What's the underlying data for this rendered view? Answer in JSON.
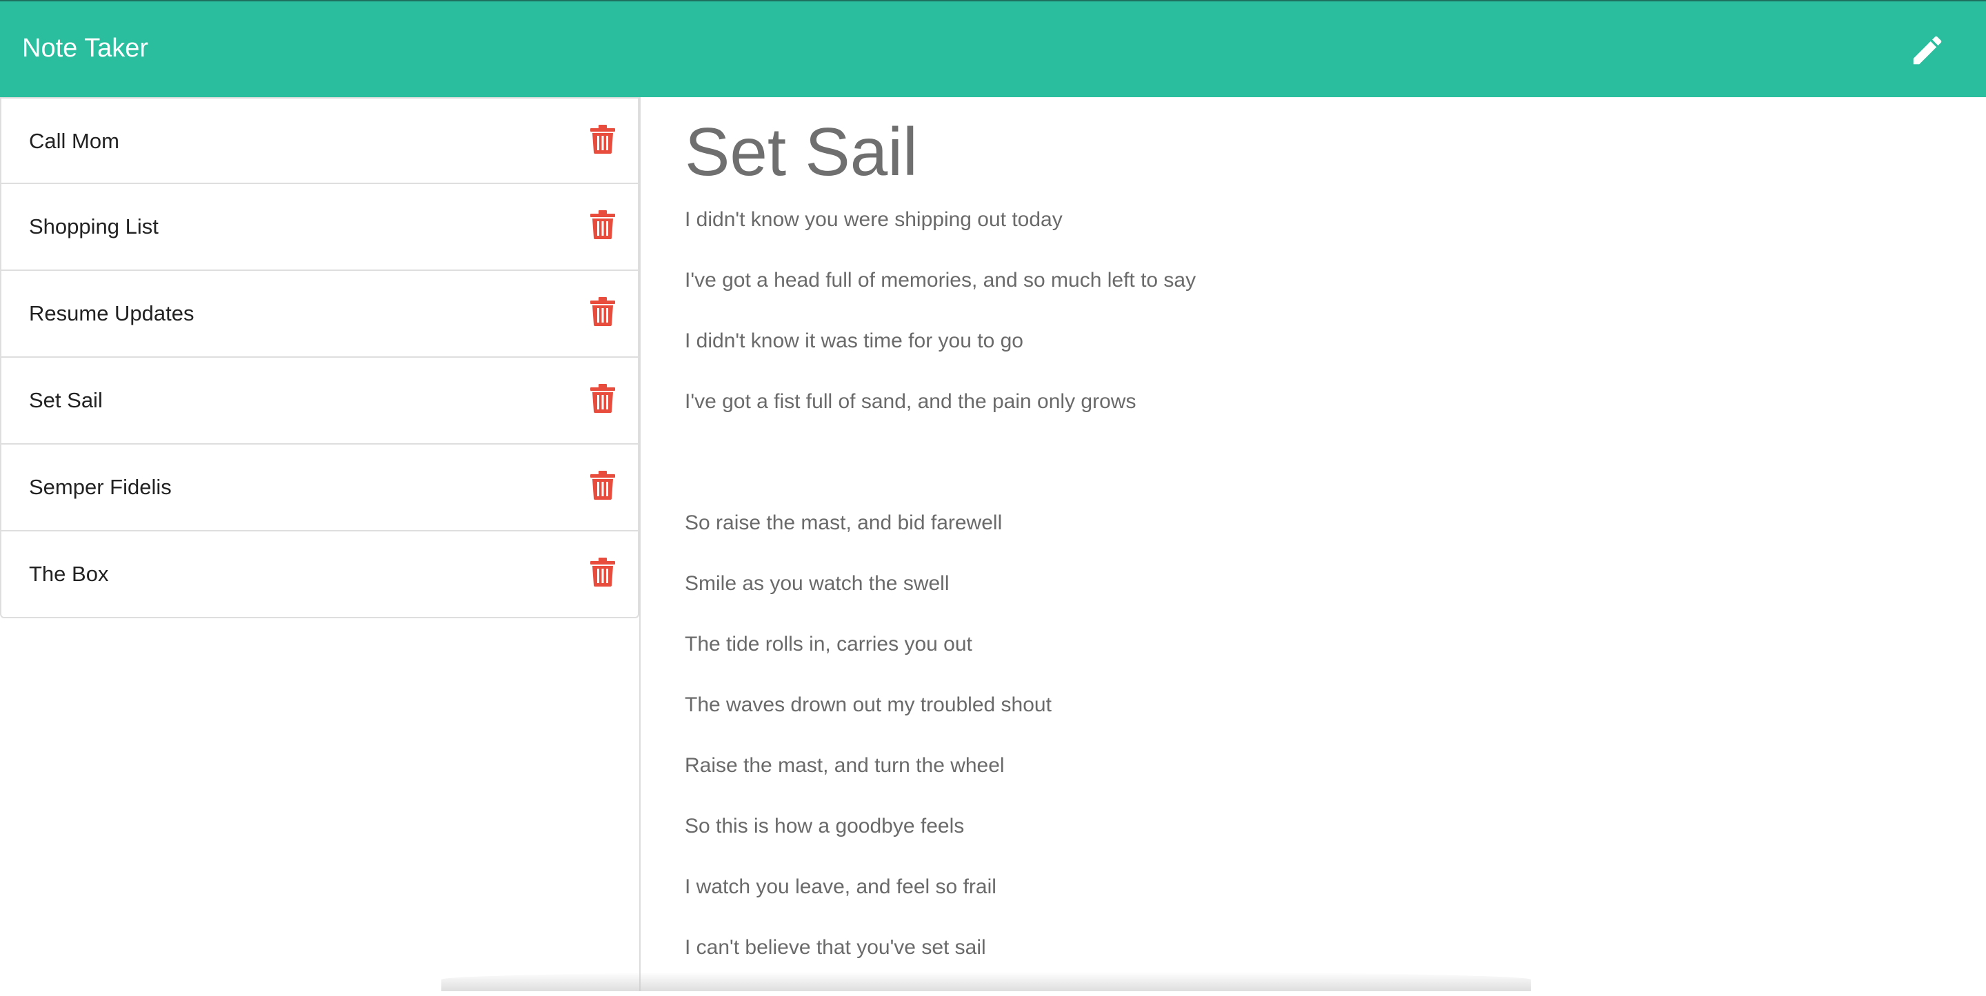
{
  "app": {
    "title": "Note Taker"
  },
  "toolbar": {
    "new_note_icon": "pencil-icon"
  },
  "notes": [
    {
      "title": "Call Mom"
    },
    {
      "title": "Shopping List"
    },
    {
      "title": "Resume Updates"
    },
    {
      "title": "Set Sail"
    },
    {
      "title": "Semper Fidelis"
    },
    {
      "title": "The Box"
    }
  ],
  "active_note": {
    "title": "Set Sail",
    "lines": [
      "I didn't know you were shipping out today",
      "I've got a head full of memories, and so much left to say",
      "I didn't know it was time for you to go",
      "I've got a fist full of sand, and the pain only grows",
      "",
      "So raise the mast, and bid farewell",
      "Smile as you watch the swell",
      "The tide rolls in, carries you out",
      "The waves drown out my troubled shout",
      "Raise the mast, and turn the wheel",
      "So this is how a goodbye feels",
      "I watch you leave, and feel so frail",
      "I can't believe that you've set sail"
    ]
  },
  "colors": {
    "accent": "#2abd9e",
    "delete": "#e74c3c"
  }
}
